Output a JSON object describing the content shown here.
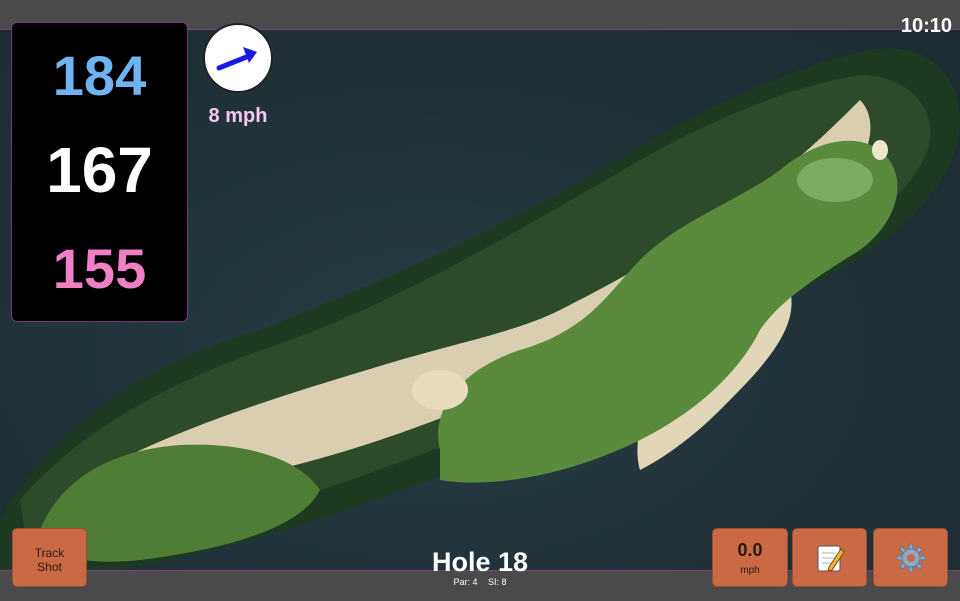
{
  "status": {
    "time": "10:10"
  },
  "distances": {
    "back": "184",
    "middle": "167",
    "front": "155"
  },
  "wind": {
    "speed": "8 mph"
  },
  "buttons": {
    "track_shot_line1": "Track",
    "track_shot_line2": "Shot",
    "speed_value": "0.0",
    "speed_unit": "mph",
    "notes_icon": "notepad-icon",
    "settings_icon": "gear-icon"
  },
  "hole": {
    "title": "Hole 18",
    "par": "Par: 4",
    "si": "SI: 8"
  },
  "colors": {
    "back_distance": "#6fb3f2",
    "middle_distance": "#ffffff",
    "front_distance": "#f07fc6",
    "button": "#c96a45",
    "wind_text": "#f5c9f0",
    "wind_arrow": "#1a1ae6"
  }
}
